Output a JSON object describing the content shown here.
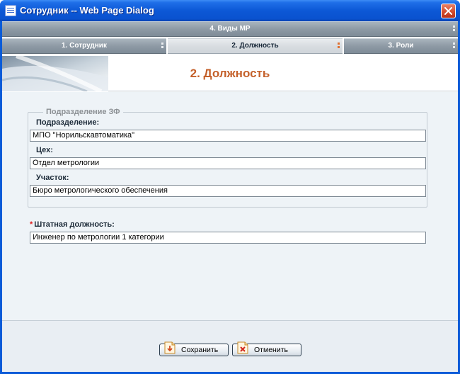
{
  "window": {
    "title": "Сотрудник -- Web Page Dialog"
  },
  "tabs": {
    "top": {
      "label": "4. Виды МР"
    },
    "row": [
      {
        "label": "1. Сотрудник",
        "active": false
      },
      {
        "label": "2. Должность",
        "active": true
      },
      {
        "label": "3. Роли",
        "active": false
      }
    ]
  },
  "page": {
    "title": "2. Должность"
  },
  "group": {
    "legend": "Подразделение ЗФ",
    "division_label": "Подразделение:",
    "division_value": "МПО \"Норильскавтоматика\"",
    "shop_label": "Цех:",
    "shop_value": "Отдел метрологии",
    "section_label": "Участок:",
    "section_value": "Бюро метрологического обеспечения"
  },
  "position": {
    "required_mark": "*",
    "label": "Штатная должность:",
    "value": "Инженер по метрологии 1 категории"
  },
  "footer": {
    "save_label": "Сохранить",
    "cancel_label": "Отменить"
  },
  "colors": {
    "title_bar": "#0a52cf",
    "page_title": "#c4602a",
    "required": "#e01a1a",
    "content_bg": "#eef3f7"
  },
  "icons": {
    "window": "page-icon",
    "close": "close-icon",
    "save": "save-icon",
    "cancel": "cancel-icon"
  }
}
